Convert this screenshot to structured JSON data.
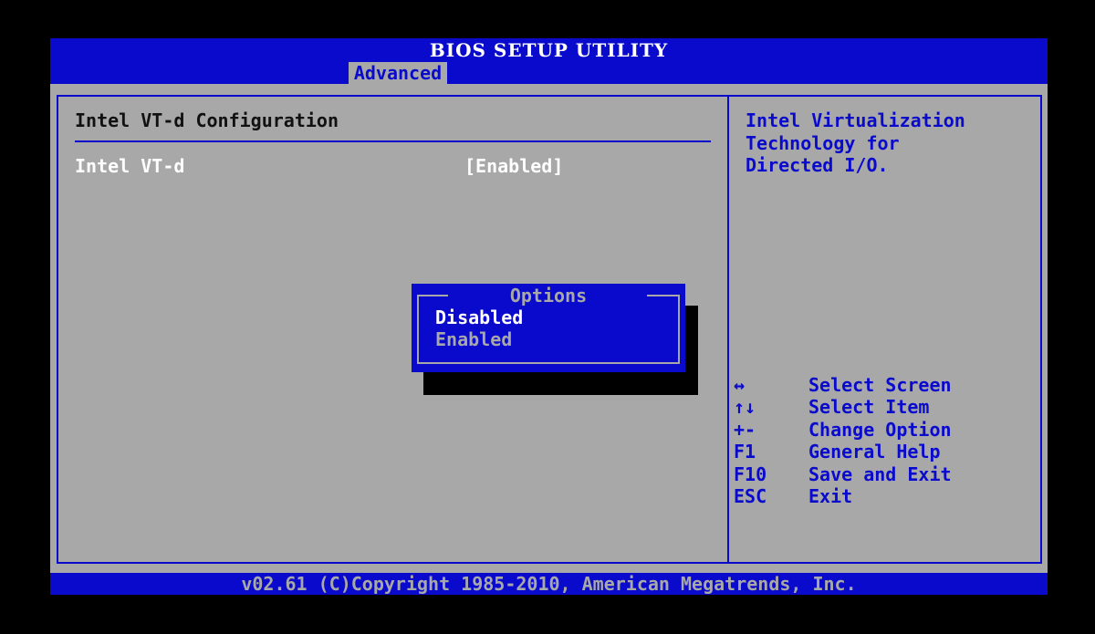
{
  "header": {
    "title": "BIOS SETUP UTILITY",
    "active_tab": "Advanced"
  },
  "main": {
    "section_title": "Intel VT-d Configuration",
    "settings": [
      {
        "name": "Intel VT-d",
        "value": "[Enabled]"
      }
    ]
  },
  "help": {
    "lines": [
      "Intel Virtualization",
      "Technology for",
      "Directed I/O."
    ]
  },
  "keys": [
    {
      "key": "↔",
      "action": "Select Screen"
    },
    {
      "key": "↑↓",
      "action": "Select Item"
    },
    {
      "key": "+-",
      "action": "Change Option"
    },
    {
      "key": "F1",
      "action": "General Help"
    },
    {
      "key": "F10",
      "action": "Save and Exit"
    },
    {
      "key": "ESC",
      "action": "Exit"
    }
  ],
  "popup": {
    "title": "Options",
    "options": [
      "Disabled",
      "Enabled"
    ],
    "selected": "Disabled"
  },
  "footer": {
    "copyright": "v02.61 (C)Copyright 1985-2010, American Megatrends, Inc."
  },
  "colors": {
    "bios_blue": "#0a0acc",
    "panel_gray": "#a8a8a8",
    "highlight_white": "#ffffff"
  }
}
